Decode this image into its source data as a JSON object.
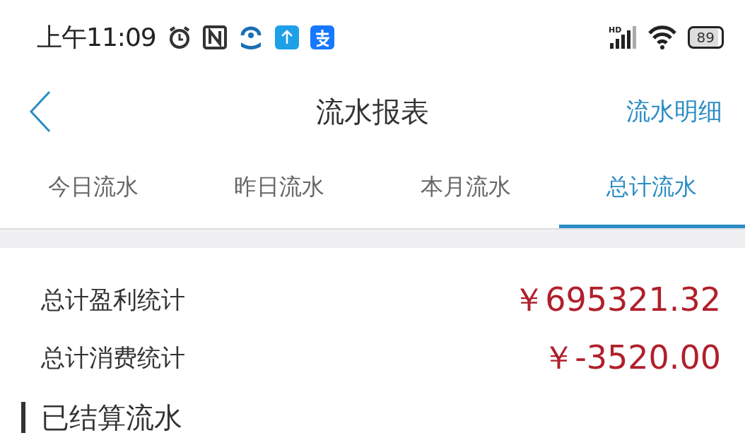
{
  "status_bar": {
    "time": "上午11:09",
    "signal_label": "HD",
    "battery": "89"
  },
  "nav": {
    "title": "流水报表",
    "action": "流水明细"
  },
  "tabs": [
    {
      "label": "今日流水",
      "selected": false
    },
    {
      "label": "昨日流水",
      "selected": false
    },
    {
      "label": "本月流水",
      "selected": false
    },
    {
      "label": "总计流水",
      "selected": true
    }
  ],
  "stats": [
    {
      "label": "总计盈利统计",
      "value": "￥695321.32"
    },
    {
      "label": "总计消费统计",
      "value": "￥-3520.00"
    }
  ],
  "section": {
    "title": "已结算流水"
  }
}
